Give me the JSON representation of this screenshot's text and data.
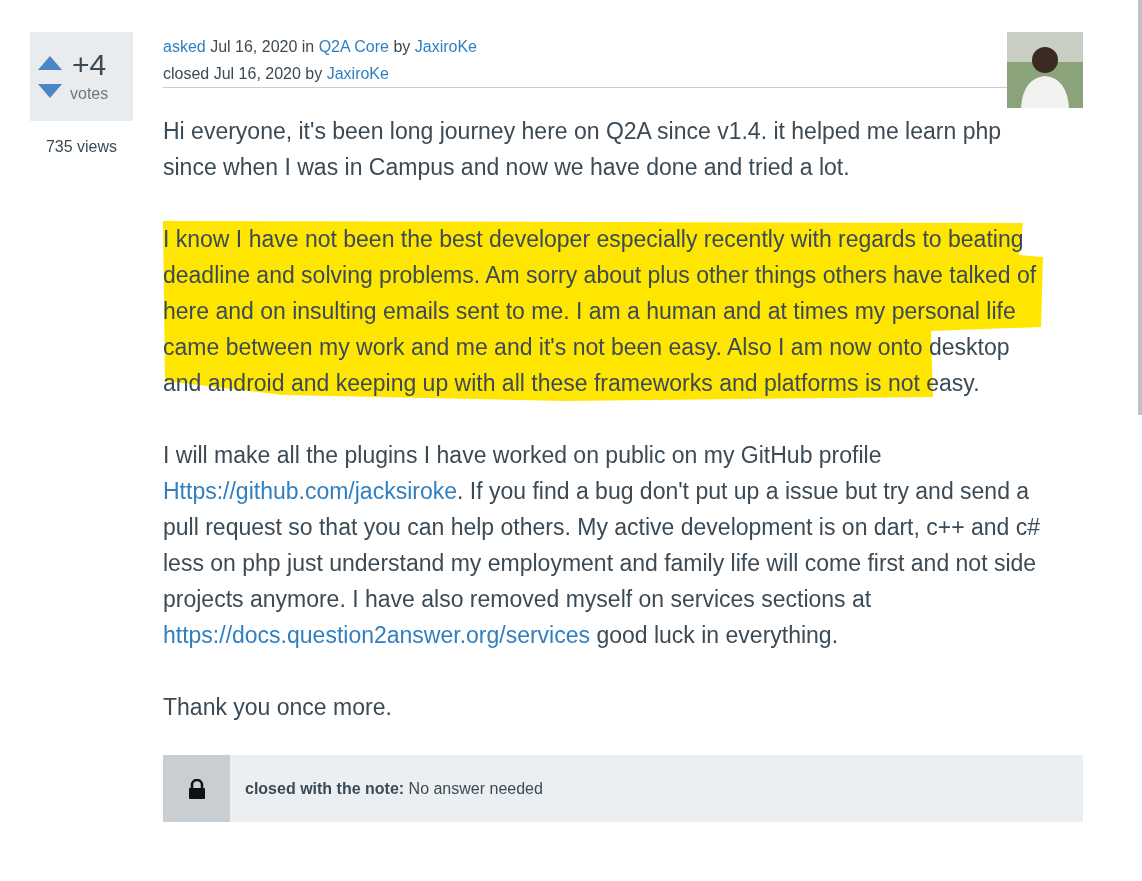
{
  "vote": {
    "count": "+4",
    "label": "votes"
  },
  "views": "735 views",
  "meta": [
    {
      "segments": [
        {
          "kind": "link",
          "text": "asked"
        },
        {
          "kind": "text",
          "text": " Jul 16, 2020 in "
        },
        {
          "kind": "link",
          "text": "Q2A Core"
        },
        {
          "kind": "text",
          "text": " by "
        },
        {
          "kind": "link",
          "text": "JaxiroKe"
        }
      ]
    },
    {
      "segments": [
        {
          "kind": "text",
          "text": "closed Jul 16, 2020 by "
        },
        {
          "kind": "link",
          "text": "JaxiroKe"
        }
      ]
    }
  ],
  "paragraphs": [
    {
      "highlighted": false,
      "segments": [
        {
          "kind": "text",
          "text": "Hi everyone, it's been long journey here on Q2A since v1.4. it helped me learn php since when I was in Campus and now we have done and tried a lot."
        }
      ]
    },
    {
      "highlighted": true,
      "segments": [
        {
          "kind": "text",
          "text": "I know I have not been the best developer especially recently with regards to beating deadline and solving problems. Am sorry about plus other things others have talked of here and on insulting emails sent to me. I am a human and at times my personal life came between my work and me and it's not been easy. Also I am now onto desktop and android and keeping up with all these frameworks and platforms is not easy."
        }
      ]
    },
    {
      "highlighted": false,
      "segments": [
        {
          "kind": "text",
          "text": "I will make all the plugins I have worked on public on my GitHub profile "
        },
        {
          "kind": "link",
          "text": "Https://github.com/jacksiroke"
        },
        {
          "kind": "text",
          "text": ". If you find a bug don't put up a issue but try and send a pull request so that you can help others. My active development is on dart, c++ and c# less on php just understand my employment and family life will come first and not side projects anymore. I have also removed myself on services sections at "
        },
        {
          "kind": "link",
          "text": "https://docs.question2answer.org/services"
        },
        {
          "kind": "text",
          "text": " good luck in everything."
        }
      ]
    },
    {
      "highlighted": false,
      "segments": [
        {
          "kind": "text",
          "text": "Thank you once more."
        }
      ]
    }
  ],
  "closed_note": {
    "label": "closed with the note:",
    "text": "No answer needed"
  }
}
